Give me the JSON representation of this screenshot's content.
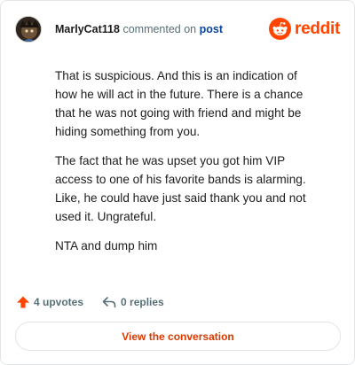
{
  "comment": {
    "username": "MarlyCat118",
    "action_text": "commented on",
    "post_link": "post",
    "paragraphs": [
      "That is suspicious. And this is an indication of how he will act in the future. There is a chance that he was not going with friend and might be hiding something from you.",
      "The fact that he was upset you got him VIP access to one of his favorite bands is alarming. Like, he could have just said thank you and not used it. Ungrateful.",
      "NTA and dump him"
    ]
  },
  "brand": {
    "wordmark": "reddit",
    "logo_icon": "reddit-snoo-icon",
    "accent_color": "#ff4500"
  },
  "actions": {
    "upvotes_label": "4 upvotes",
    "upvote_icon": "upvote-arrow-icon",
    "replies_label": "0 replies",
    "reply_icon": "reply-arrow-icon"
  },
  "cta": {
    "label": "View the conversation",
    "color": "#d93900"
  }
}
